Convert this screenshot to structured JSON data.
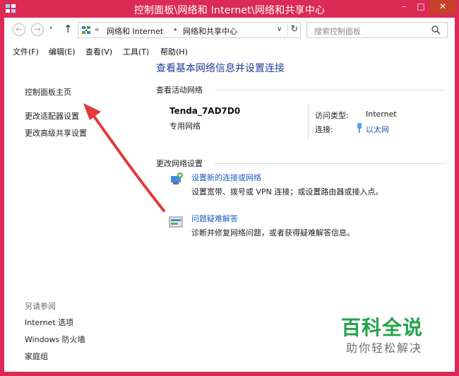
{
  "window": {
    "title": "控制面板\\网络和 Internet\\网络和共享中心",
    "minimize": "–",
    "maximize": "□",
    "close": "✕"
  },
  "address": {
    "back": "←",
    "forward": "→",
    "recent": "▾",
    "up": "↑",
    "overflow": "«",
    "crumbs": [
      "网络和 Internet",
      "网络和共享中心"
    ],
    "crumb_sep": "▸",
    "dropdown": "∨",
    "refresh": "↻",
    "search_placeholder": "搜索控制面板"
  },
  "menu": [
    "文件(F)",
    "编辑(E)",
    "查看(V)",
    "工具(T)",
    "帮助(H)"
  ],
  "left_pane": {
    "links": [
      "控制面板主页",
      "更改适配器设置",
      "更改高级共享设置"
    ],
    "see_also_title": "另请参阅",
    "see_also": [
      "Internet 选项",
      "Windows 防火墙",
      "家庭组"
    ]
  },
  "main": {
    "title": "查看基本网络信息并设置连接",
    "active_header": "查看活动网络",
    "network_name": "Tenda_7AD7D0",
    "network_type": "专用网络",
    "access_type_label": "访问类型:",
    "access_type_value": "Internet",
    "connection_label": "连接:",
    "connection_value": "以太网",
    "change_header": "更改网络设置",
    "tasks": [
      {
        "link": "设置新的连接或网络",
        "desc": "设置宽带、拨号或 VPN 连接；或设置路由器或接入点。"
      },
      {
        "link": "问题疑难解答",
        "desc": "诊断并修复网络问题，或者获得疑难解答信息。"
      }
    ]
  },
  "watermark": {
    "logo": "百科全说",
    "tagline": "助你轻松解决"
  },
  "colors": {
    "frame": "#da2a55",
    "link": "#1a5fb4",
    "title": "#1f3f95",
    "arrow": "#e03a3a",
    "watermark": "#23a24a"
  }
}
